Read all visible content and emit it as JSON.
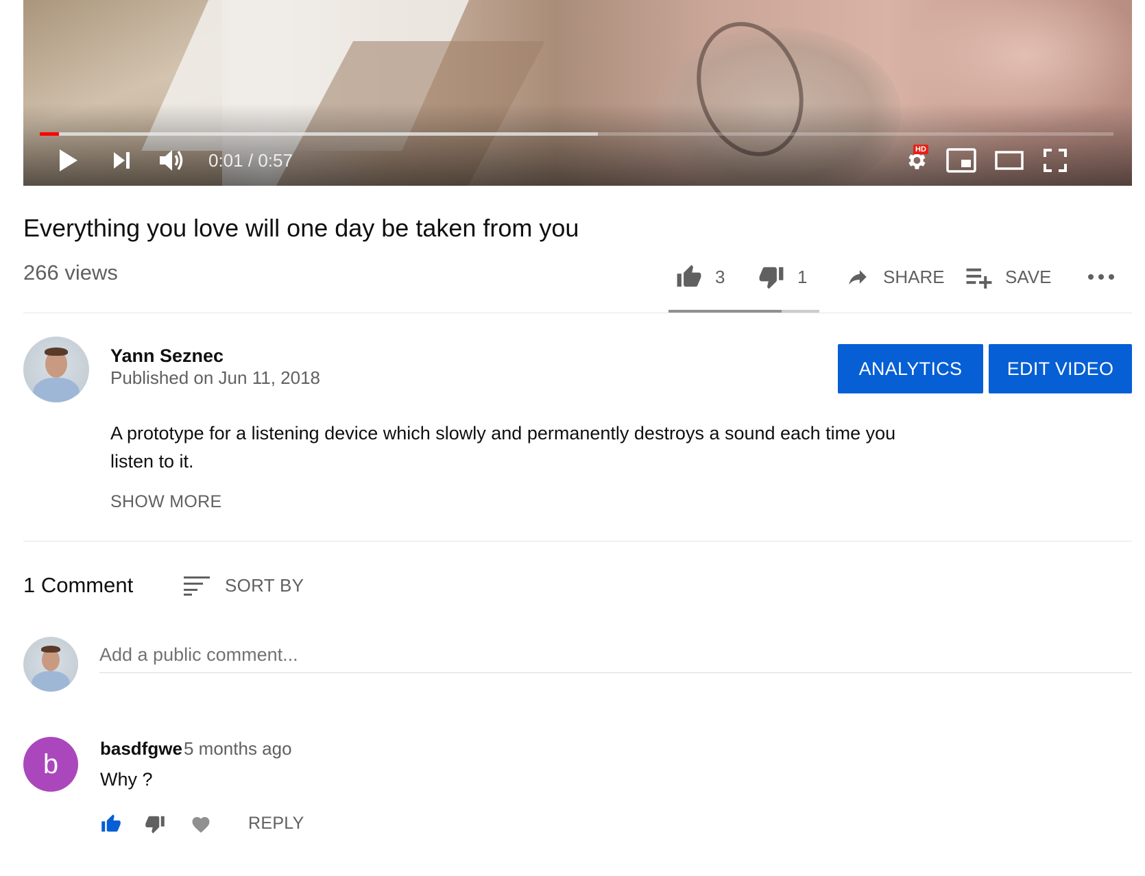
{
  "player": {
    "current_time": "0:01",
    "separator": "/",
    "duration": "0:57",
    "played_fraction": 0.018,
    "buffered_fraction": 0.52,
    "quality_badge": "HD",
    "accent_color": "#ff0000"
  },
  "video": {
    "title": "Everything you love will one day be taken from you",
    "views": "266 views",
    "likes": "3",
    "dislikes": "1",
    "like_fraction": 0.75,
    "share_label": "SHARE",
    "save_label": "SAVE",
    "more_icon": "more-horizontal-icon"
  },
  "owner": {
    "name": "Yann Seznec",
    "published": "Published on Jun 11, 2018",
    "analytics_label": "ANALYTICS",
    "edit_label": "EDIT VIDEO",
    "button_color": "#065fd4"
  },
  "description": {
    "text": "A prototype for a listening device which slowly and permanently destroys a sound each time you listen to it.",
    "show_more": "SHOW MORE"
  },
  "comments": {
    "count_label": "1 Comment",
    "sort_label": "SORT BY",
    "input_placeholder": "Add a public comment...",
    "items": [
      {
        "avatar_letter": "b",
        "avatar_color": "#ab47bc",
        "author": "basdfgwe",
        "time": "5 months ago",
        "text": "Why ?",
        "reply_label": "REPLY",
        "liked_color": "#065fd4"
      }
    ]
  }
}
